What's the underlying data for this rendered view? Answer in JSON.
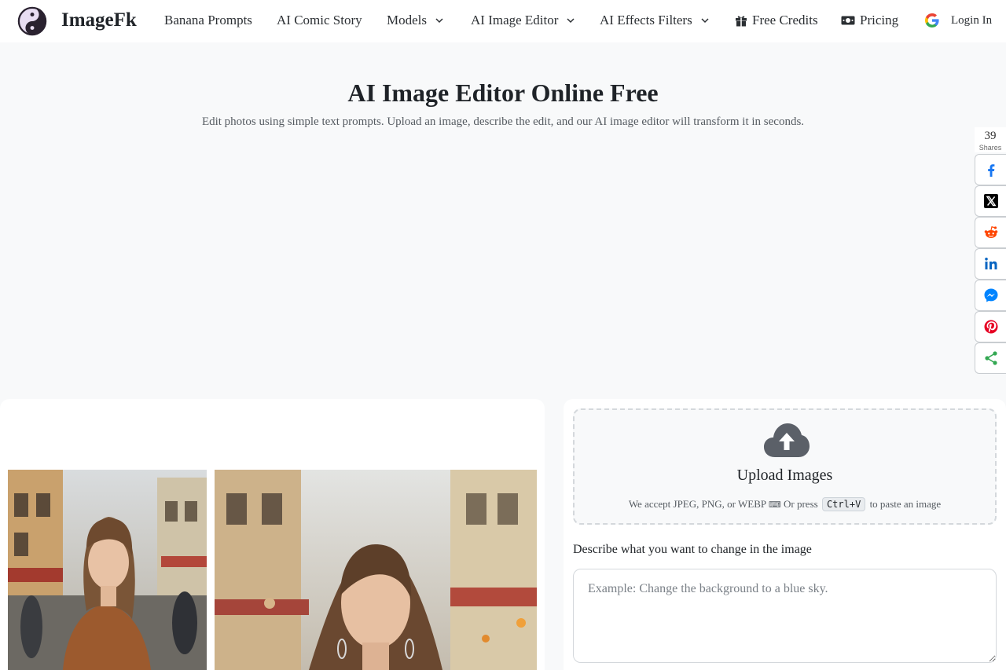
{
  "brand": {
    "name": "ImageFk",
    "logo_icon": "yin-yang-icon"
  },
  "nav": {
    "items": [
      {
        "label": "Banana Prompts"
      },
      {
        "label": "AI Comic Story"
      },
      {
        "label": "Models",
        "has_dropdown": true
      },
      {
        "label": "AI Image Editor",
        "has_dropdown": true
      },
      {
        "label": "AI Effects Filters",
        "has_dropdown": true
      },
      {
        "label": "Free Credits",
        "icon": "gift-icon"
      },
      {
        "label": "Pricing",
        "icon": "money-icon"
      }
    ],
    "login": {
      "label": "Login In",
      "icon": "google-icon"
    }
  },
  "hero": {
    "title": "AI Image Editor Online Free",
    "subtitle": "Edit photos using simple text prompts. Upload an image, describe the edit, and our AI image editor will transform it in seconds."
  },
  "share": {
    "count": "39",
    "label": "Shares",
    "buttons": [
      "facebook-icon",
      "x-icon",
      "reddit-icon",
      "linkedin-icon",
      "messenger-icon",
      "pinterest-icon",
      "share-icon"
    ]
  },
  "upload": {
    "title": "Upload Images",
    "hint_before": "We accept JPEG, PNG, or WEBP",
    "hint_middle": "Or press",
    "shortcut": "Ctrl+V",
    "hint_after": "to paste an image"
  },
  "prompt": {
    "label": "Describe what you want to change in the image",
    "placeholder": "Example: Change the background to a blue sky.",
    "value": ""
  },
  "colors": {
    "facebook": "#1877f2",
    "reddit": "#ff4500",
    "linkedin": "#0a66c2",
    "messenger": "#0084ff",
    "pinterest": "#e60023",
    "share": "#34a853",
    "cloud": "#5b6068"
  }
}
